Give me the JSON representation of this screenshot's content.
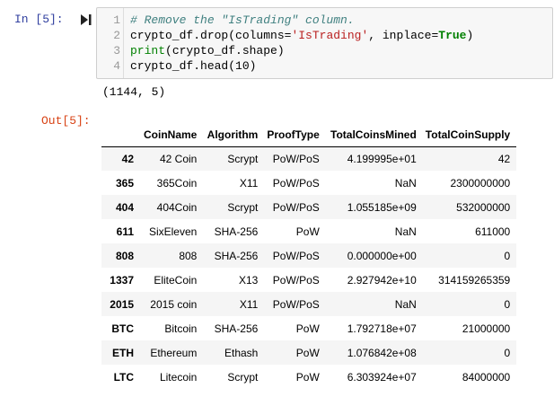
{
  "cell": {
    "in_prompt": "In [5]:",
    "out_prompt": "Out[5]:",
    "run_icon": "step-forward-icon",
    "line_numbers": [
      "1",
      "2",
      "3",
      "4"
    ],
    "code": [
      {
        "comment": "# Remove the \"IsTrading\" column."
      },
      {
        "pre": "crypto_df.drop(columns=",
        "str": "'IsTrading'",
        "mid": ", inplace=",
        "kw": "True",
        "post": ")"
      },
      {
        "builtin": "print",
        "post": "(crypto_df.shape)"
      },
      {
        "plain": "crypto_df.head(10)"
      }
    ],
    "stream_output": "(1144, 5)"
  },
  "dataframe": {
    "columns": [
      "",
      "CoinName",
      "Algorithm",
      "ProofType",
      "TotalCoinsMined",
      "TotalCoinSupply"
    ],
    "rows": [
      {
        "index": "42",
        "CoinName": "42 Coin",
        "Algorithm": "Scrypt",
        "ProofType": "PoW/PoS",
        "TotalCoinsMined": "4.199995e+01",
        "TotalCoinSupply": "42"
      },
      {
        "index": "365",
        "CoinName": "365Coin",
        "Algorithm": "X11",
        "ProofType": "PoW/PoS",
        "TotalCoinsMined": "NaN",
        "TotalCoinSupply": "2300000000"
      },
      {
        "index": "404",
        "CoinName": "404Coin",
        "Algorithm": "Scrypt",
        "ProofType": "PoW/PoS",
        "TotalCoinsMined": "1.055185e+09",
        "TotalCoinSupply": "532000000"
      },
      {
        "index": "611",
        "CoinName": "SixEleven",
        "Algorithm": "SHA-256",
        "ProofType": "PoW",
        "TotalCoinsMined": "NaN",
        "TotalCoinSupply": "611000"
      },
      {
        "index": "808",
        "CoinName": "808",
        "Algorithm": "SHA-256",
        "ProofType": "PoW/PoS",
        "TotalCoinsMined": "0.000000e+00",
        "TotalCoinSupply": "0"
      },
      {
        "index": "1337",
        "CoinName": "EliteCoin",
        "Algorithm": "X13",
        "ProofType": "PoW/PoS",
        "TotalCoinsMined": "2.927942e+10",
        "TotalCoinSupply": "314159265359"
      },
      {
        "index": "2015",
        "CoinName": "2015 coin",
        "Algorithm": "X11",
        "ProofType": "PoW/PoS",
        "TotalCoinsMined": "NaN",
        "TotalCoinSupply": "0"
      },
      {
        "index": "BTC",
        "CoinName": "Bitcoin",
        "Algorithm": "SHA-256",
        "ProofType": "PoW",
        "TotalCoinsMined": "1.792718e+07",
        "TotalCoinSupply": "21000000"
      },
      {
        "index": "ETH",
        "CoinName": "Ethereum",
        "Algorithm": "Ethash",
        "ProofType": "PoW",
        "TotalCoinsMined": "1.076842e+08",
        "TotalCoinSupply": "0"
      },
      {
        "index": "LTC",
        "CoinName": "Litecoin",
        "Algorithm": "Scrypt",
        "ProofType": "PoW",
        "TotalCoinsMined": "6.303924e+07",
        "TotalCoinSupply": "84000000"
      }
    ]
  }
}
